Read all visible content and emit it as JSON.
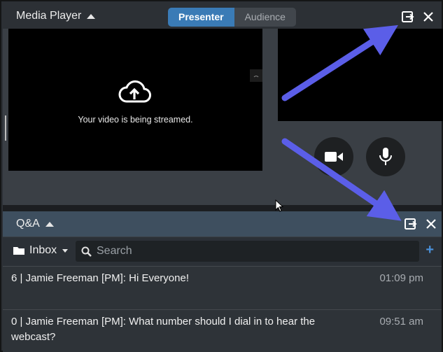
{
  "media_player": {
    "title": "Media Player",
    "toggle": {
      "presenter": "Presenter",
      "audience": "Audience"
    },
    "stream_message": "Your video is being streamed."
  },
  "qa": {
    "title": "Q&A",
    "inbox_label": "Inbox",
    "search_placeholder": "Search",
    "messages": [
      {
        "text": "6 | Jamie Freeman [PM]: Hi Everyone!",
        "time": "01:09 pm"
      },
      {
        "text": "0 | Jamie Freeman [PM]: What number should I dial in to hear the webcast?",
        "time": "09:51 am"
      }
    ]
  },
  "colors": {
    "accent": "#3a7bb6",
    "annotation_arrow": "#5b5ee8",
    "add_button": "#4a90d9"
  },
  "icons": [
    "caret-up-icon",
    "popout-icon",
    "close-icon",
    "cloud-upload-icon",
    "video-camera-icon",
    "microphone-icon",
    "folder-icon",
    "caret-down-icon",
    "search-icon",
    "plus-icon",
    "mouse-cursor-icon"
  ]
}
